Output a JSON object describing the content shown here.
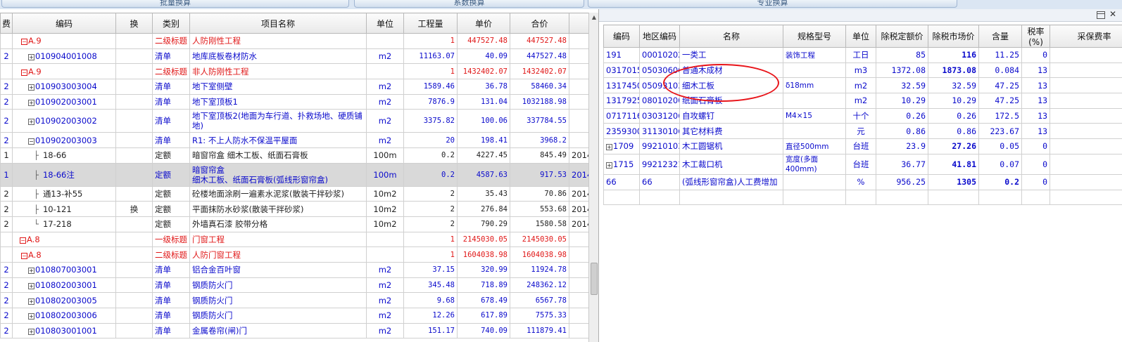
{
  "top_tabs": [
    "批量换算",
    "系数换算",
    "专业换算"
  ],
  "left_table": {
    "headers": [
      "费",
      "编码",
      "换",
      "类别",
      "项目名称",
      "单位",
      "工程量",
      "单价",
      "合价",
      ""
    ],
    "rows": [
      {
        "fee": "",
        "code": "A.9",
        "tree": "",
        "box": "minus",
        "swap": "",
        "cat": "二级标题",
        "name": "人防刚性工程",
        "unit": "",
        "qty": "1",
        "price": "447527.48",
        "total": "447527.48",
        "extra": "",
        "style": "red cut"
      },
      {
        "fee": "2",
        "code": "010904001008",
        "tree": "",
        "box": "plus",
        "swap": "",
        "cat": "清单",
        "name": "地库底板卷材防水",
        "unit": "m2",
        "qty": "11163.07",
        "price": "40.09",
        "total": "447527.48",
        "extra": "",
        "style": "blue"
      },
      {
        "fee": "",
        "code": "A.9",
        "tree": "",
        "box": "minus",
        "swap": "",
        "cat": "二级标题",
        "name": "非人防刚性工程",
        "unit": "",
        "qty": "1",
        "price": "1432402.07",
        "total": "1432402.07",
        "extra": "",
        "style": "red"
      },
      {
        "fee": "2",
        "code": "010903003004",
        "tree": "",
        "box": "plus",
        "swap": "",
        "cat": "清单",
        "name": "地下室侧壁",
        "unit": "m2",
        "qty": "1589.46",
        "price": "36.78",
        "total": "58460.34",
        "extra": "",
        "style": "blue"
      },
      {
        "fee": "2",
        "code": "010902003001",
        "tree": "",
        "box": "plus",
        "swap": "",
        "cat": "清单",
        "name": "地下室顶板1",
        "unit": "m2",
        "qty": "7876.9",
        "price": "131.04",
        "total": "1032188.98",
        "extra": "",
        "style": "blue"
      },
      {
        "fee": "2",
        "code": "010902003002",
        "tree": "",
        "box": "plus",
        "swap": "",
        "cat": "清单",
        "name": "地下室顶板2(地面为车行道、扑救场地、硬质铺地)",
        "unit": "m2",
        "qty": "3375.82",
        "price": "100.06",
        "total": "337784.55",
        "extra": "",
        "style": "blue tall"
      },
      {
        "fee": "2",
        "code": "010902003003",
        "tree": "",
        "box": "minus",
        "swap": "",
        "cat": "清单",
        "name": "R1: 不上人防水不保温平屋面",
        "unit": "m2",
        "qty": "20",
        "price": "198.41",
        "total": "3968.2",
        "extra": "",
        "style": "blue"
      },
      {
        "fee": "1",
        "code": "18-66",
        "tree": "├",
        "box": "",
        "swap": "",
        "cat": "定额",
        "name": "暗窗帘盒 细木工板、纸面石膏板",
        "unit": "100m",
        "qty": "0.2",
        "price": "4227.45",
        "total": "845.49",
        "extra": "2014",
        "style": "black"
      },
      {
        "fee": "1",
        "code": "18-66注",
        "tree": "├",
        "box": "",
        "swap": "",
        "cat": "定额",
        "name": "暗窗帘盒\n细木工板、纸面石膏板(弧线形窗帘盒)",
        "unit": "100m",
        "qty": "0.2",
        "price": "4587.63",
        "total": "917.53",
        "extra": "2014",
        "style": "blue sel tall"
      },
      {
        "fee": "2",
        "code": "通13-补55",
        "tree": "├",
        "box": "",
        "swap": "",
        "cat": "定额",
        "name": "砼楼地面涂刷一遍素水泥浆(散装干拌砂浆)",
        "unit": "10m2",
        "qty": "2",
        "price": "35.43",
        "total": "70.86",
        "extra": "2014",
        "style": "black"
      },
      {
        "fee": "2",
        "code": "10-121",
        "tree": "├",
        "box": "",
        "swap": "换",
        "cat": "定额",
        "name": "平面抹防水砂浆(散装干拌砂浆)",
        "unit": "10m2",
        "qty": "2",
        "price": "276.84",
        "total": "553.68",
        "extra": "2014",
        "style": "black"
      },
      {
        "fee": "2",
        "code": "17-218",
        "tree": "└",
        "box": "",
        "swap": "",
        "cat": "定额",
        "name": "外墙真石漆 胶带分格",
        "unit": "10m2",
        "qty": "2",
        "price": "790.29",
        "total": "1580.58",
        "extra": "2014",
        "style": "black"
      },
      {
        "fee": "",
        "code": "A.8",
        "tree": "",
        "box": "minus",
        "swap": "",
        "cat": "一级标题",
        "name": "门窗工程",
        "unit": "",
        "qty": "1",
        "price": "2145030.05",
        "total": "2145030.05",
        "extra": "",
        "style": "red lvl1"
      },
      {
        "fee": "",
        "code": "A.8",
        "tree": "",
        "box": "minus",
        "swap": "",
        "cat": "二级标题",
        "name": "人防门窗工程",
        "unit": "",
        "qty": "1",
        "price": "1604038.98",
        "total": "1604038.98",
        "extra": "",
        "style": "red"
      },
      {
        "fee": "2",
        "code": "010807003001",
        "tree": "",
        "box": "plus",
        "swap": "",
        "cat": "清单",
        "name": "铝合金百叶窗",
        "unit": "m2",
        "qty": "37.15",
        "price": "320.99",
        "total": "11924.78",
        "extra": "",
        "style": "blue"
      },
      {
        "fee": "2",
        "code": "010802003001",
        "tree": "",
        "box": "plus",
        "swap": "",
        "cat": "清单",
        "name": "钢质防火门",
        "unit": "m2",
        "qty": "345.48",
        "price": "718.89",
        "total": "248362.12",
        "extra": "",
        "style": "blue"
      },
      {
        "fee": "2",
        "code": "010802003005",
        "tree": "",
        "box": "plus",
        "swap": "",
        "cat": "清单",
        "name": "钢质防火门",
        "unit": "m2",
        "qty": "9.68",
        "price": "678.49",
        "total": "6567.78",
        "extra": "",
        "style": "blue"
      },
      {
        "fee": "2",
        "code": "010802003006",
        "tree": "",
        "box": "plus",
        "swap": "",
        "cat": "清单",
        "name": "钢质防火门",
        "unit": "m2",
        "qty": "12.26",
        "price": "617.89",
        "total": "7575.33",
        "extra": "",
        "style": "blue"
      },
      {
        "fee": "2",
        "code": "010803001001",
        "tree": "",
        "box": "plus",
        "swap": "",
        "cat": "清单",
        "name": "金属卷帘(闸)门",
        "unit": "m2",
        "qty": "151.17",
        "price": "740.09",
        "total": "111879.41",
        "extra": "",
        "style": "blue"
      }
    ]
  },
  "right_table": {
    "headers": [
      "编码",
      "地区编码",
      "名称",
      "规格型号",
      "单位",
      "除税定额价",
      "除税市场价",
      "含量",
      "税率(%)",
      "采保费率"
    ],
    "rows": [
      {
        "code": "191",
        "area": "00010202",
        "box": "",
        "name": "一类工",
        "spec": "装饰工程",
        "unit": "工日",
        "base": "85",
        "market": "116",
        "qty": "11.25",
        "tax": "0",
        "fee": "0",
        "bold": true
      },
      {
        "code": "0317015",
        "area": "05030600",
        "box": "",
        "name": "普通木成材",
        "spec": "",
        "unit": "m3",
        "base": "1372.08",
        "market": "1873.08",
        "qty": "0.084",
        "tax": "13",
        "fee": "2",
        "bold": true
      },
      {
        "code": "1317450",
        "area": "05093103",
        "box": "",
        "name": "细木工板",
        "spec": "δ18mm",
        "unit": "m2",
        "base": "32.59",
        "market": "32.59",
        "qty": "47.25",
        "tax": "13",
        "fee": "2",
        "bold": false
      },
      {
        "code": "1317925",
        "area": "08010200",
        "box": "",
        "name": "纸面石膏板",
        "spec": "",
        "unit": "m2",
        "base": "10.29",
        "market": "10.29",
        "qty": "47.25",
        "tax": "13",
        "fee": "2",
        "bold": false
      },
      {
        "code": "0717116",
        "area": "03031206",
        "box": "",
        "name": "自攻螺钉",
        "spec": "M4×15",
        "unit": "十个",
        "base": "0.26",
        "market": "0.26",
        "qty": "172.5",
        "tax": "13",
        "fee": "2",
        "bold": false
      },
      {
        "code": "2359300",
        "area": "31130106",
        "box": "",
        "name": "其它材料费",
        "spec": "",
        "unit": "元",
        "base": "0.86",
        "market": "0.86",
        "qty": "223.67",
        "tax": "13",
        "fee": "2",
        "bold": false
      },
      {
        "code": "1709",
        "area": "99210103",
        "box": "plus",
        "name": "木工圆锯机",
        "spec": "直径500mm",
        "unit": "台班",
        "base": "23.9",
        "market": "27.26",
        "qty": "0.05",
        "tax": "0",
        "fee": "2",
        "bold": true
      },
      {
        "code": "1715",
        "area": "99212321",
        "box": "plus",
        "name": "木工裁口机",
        "spec": "宽度(多面400mm)",
        "unit": "台班",
        "base": "36.77",
        "market": "41.81",
        "qty": "0.07",
        "tax": "0",
        "fee": "2",
        "bold": true,
        "tall": true
      },
      {
        "code": "66",
        "area": "66",
        "box": "",
        "name": "(弧线形窗帘盒)人工费增加",
        "spec": "",
        "unit": "%",
        "base": "956.25",
        "market": "1305",
        "qty": "0.2",
        "tax": "0",
        "fee": "2",
        "bold": true,
        "boldqty": true
      },
      {
        "code": "",
        "area": "",
        "box": "",
        "name": "",
        "spec": "",
        "unit": "",
        "base": "",
        "market": "",
        "qty": "",
        "tax": "",
        "fee": "",
        "bold": false
      }
    ]
  },
  "accent": {
    "blue": "#0a0acc",
    "red": "#e01818",
    "highlight": "#e8141a"
  }
}
